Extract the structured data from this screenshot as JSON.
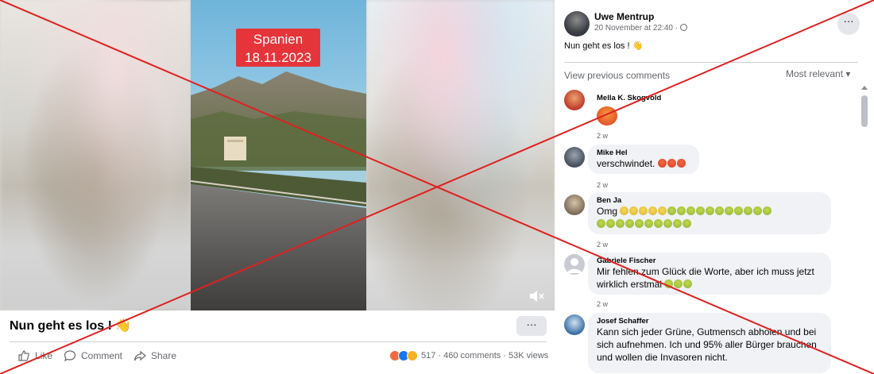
{
  "video": {
    "overlay_label_line1": "Spanien",
    "overlay_label_line2": "18.11.2023",
    "mute_icon": "speaker-muted-icon"
  },
  "post": {
    "title": "Nun geht es los !",
    "title_emoji": "👋",
    "more_label": "···",
    "actions": {
      "like": "Like",
      "comment": "Comment",
      "share": "Share"
    },
    "stats": "517 · 460 comments · 53K views",
    "reaction_colors": [
      "#f26a3b",
      "#1877f2",
      "#f7b125"
    ]
  },
  "sidebar": {
    "author": "Uwe Mentrup",
    "meta": "20 November at 22:40 ·",
    "text": "Nun geht es los ! 👋",
    "more_label": "···",
    "view_previous": "View previous comments",
    "sort_label": "Most relevant ▾"
  },
  "comments": [
    {
      "name": "Mella K. Skogvold",
      "text": "",
      "time": "2 w",
      "avatar_color": "#c0392b"
    },
    {
      "name": "Mike Hel",
      "text": "verschwindet.",
      "time": "2 w",
      "avatar_color": "#444e5c"
    },
    {
      "name": "Ben Ja",
      "text": "Omg",
      "time": "2 w",
      "avatar_color": "#7a6a58"
    },
    {
      "name": "Gabriele Fischer",
      "text": "Mir fehlen zum Glück die Worte, aber ich muss jetzt wirklich erstmal",
      "time": "2 w",
      "avatar_color": "#c8ccd2"
    },
    {
      "name": "Josef Schaffer",
      "text_line1": "Kann sich jeder Grüne, Gutmensch abholen und bei",
      "text_line2": "sich aufnehmen. Ich und 95% aller Bürger brauchen",
      "text_line3": "und wollen die Invasoren nicht.",
      "avatar_color": "#3b6ea5"
    }
  ],
  "colors": {
    "accent": "#1877f2",
    "cross": "#e02020",
    "label_bg": "#e5353a"
  }
}
